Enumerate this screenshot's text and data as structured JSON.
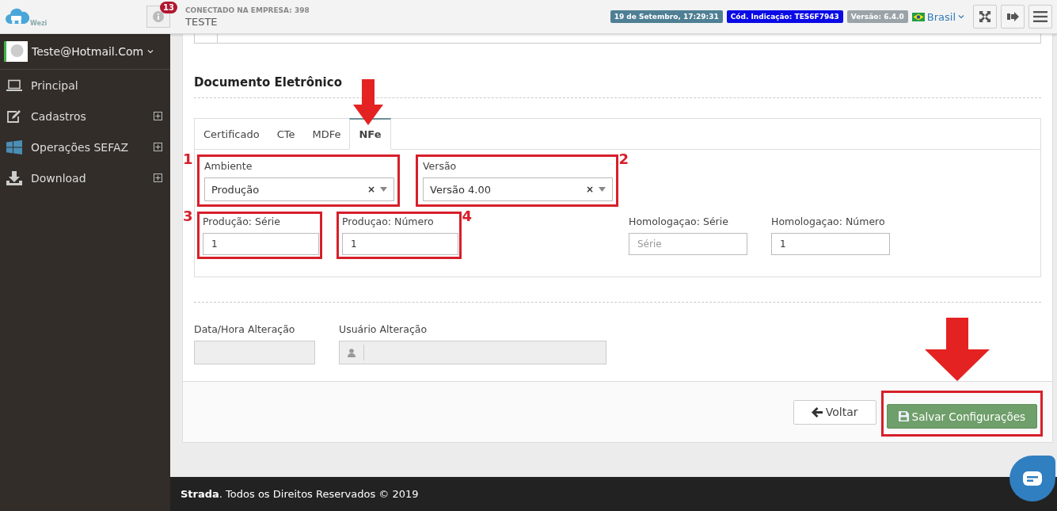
{
  "header": {
    "logo_text": "Wezi",
    "notification_count": "13",
    "company_label": "CONECTADO NA EMPRESA: 398",
    "company_name": "TESTE",
    "badges": [
      {
        "text": "19 de Setembro, 17:29:31",
        "color": "#4f7f94"
      },
      {
        "text": "Cód. Indicação: TES6F7943",
        "color": "#0a0ae6"
      },
      {
        "text": "Versão: 6.4.0",
        "color": "#9aa4a8"
      }
    ],
    "language": "Brasil"
  },
  "sidebar": {
    "user": "Teste@Hotmail.Com",
    "items": [
      {
        "label": "Principal",
        "expandable": false
      },
      {
        "label": "Cadastros",
        "expandable": true
      },
      {
        "label": "Operações SEFAZ",
        "expandable": true
      },
      {
        "label": "Download",
        "expandable": true
      }
    ]
  },
  "section": {
    "title": "Documento Eletrônico"
  },
  "tabs": [
    {
      "label": "Certificado",
      "selected": false,
      "arrow": false
    },
    {
      "label": "CTe",
      "selected": false,
      "arrow": false
    },
    {
      "label": "MDFe",
      "selected": false,
      "arrow": false
    },
    {
      "label": "NFe",
      "selected": true,
      "arrow": true
    }
  ],
  "select_fields": [
    {
      "label": "Ambiente",
      "value": "Produção",
      "clear_symbol": "×",
      "annotation": "1"
    },
    {
      "label": "Versão",
      "value": "Versão 4.00",
      "clear_symbol": "×",
      "annotation": "2"
    }
  ],
  "number_fields": [
    {
      "label": "Produção: Série",
      "value": "1",
      "annotation": "3"
    },
    {
      "label": "Produçao: Número",
      "value": "1",
      "annotation": "4"
    }
  ],
  "other_fields": [
    {
      "label": "Homologaçao: Série",
      "placeholder": "Série"
    },
    {
      "label": "Homologaçao: Número",
      "value": "1"
    }
  ],
  "audit": [
    {
      "label": "Data/Hora Alteração",
      "kind": "plain"
    },
    {
      "label": "Usuário Alteração",
      "kind": "user"
    }
  ],
  "buttons": [
    {
      "label": "Voltar",
      "kind": "back",
      "highlighted": false,
      "arrow": false
    },
    {
      "label": "Salvar Configurações",
      "kind": "save",
      "highlighted": true,
      "arrow": true
    }
  ],
  "footer": "**Strada**. Todos os Direitos Reservados © 2019"
}
